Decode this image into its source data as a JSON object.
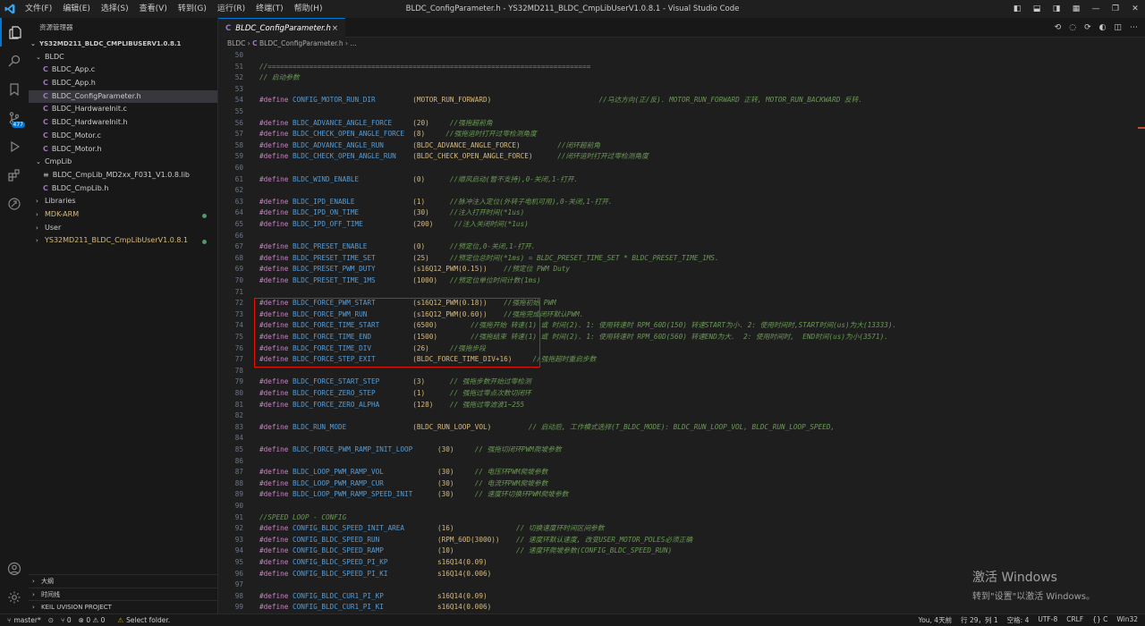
{
  "titlebar": {
    "menus": [
      "文件(F)",
      "编辑(E)",
      "选择(S)",
      "查看(V)",
      "转到(G)",
      "运行(R)",
      "终端(T)",
      "帮助(H)"
    ],
    "title": "BLDC_ConfigParameter.h - YS32MD211_BLDC_CmpLibUserV1.0.8.1 - Visual Studio Code"
  },
  "activity": {
    "badge": "477"
  },
  "sidebar": {
    "title": "资源管理器",
    "root": "YS32MD211_BLDC_CMPLIBUSERV1.0.8.1",
    "items": [
      {
        "label": "BLDC",
        "kind": "folder-open"
      },
      {
        "label": "BLDC_App.c",
        "kind": "c"
      },
      {
        "label": "BLDC_App.h",
        "kind": "c"
      },
      {
        "label": "BLDC_ConfigParameter.h",
        "kind": "c",
        "selected": true
      },
      {
        "label": "BLDC_HardwareInit.c",
        "kind": "c"
      },
      {
        "label": "BLDC_HardwareInit.h",
        "kind": "c"
      },
      {
        "label": "BLDC_Motor.c",
        "kind": "c"
      },
      {
        "label": "BLDC_Motor.h",
        "kind": "c"
      },
      {
        "label": "CmpLib",
        "kind": "folder-open"
      },
      {
        "label": "BLDC_CmpLib_MD2xx_F031_V1.0.8.lib",
        "kind": "lib"
      },
      {
        "label": "BLDC_CmpLib.h",
        "kind": "c"
      },
      {
        "label": "Libraries",
        "kind": "folder"
      },
      {
        "label": "MDK-ARM",
        "kind": "folder",
        "modified": true
      },
      {
        "label": "User",
        "kind": "folder"
      },
      {
        "label": "YS32MD211_BLDC_CmpLibUserV1.0.8.1",
        "kind": "folder",
        "modified": true
      }
    ],
    "bottom": [
      "大纲",
      "时间线",
      "KEIL UVISION PROJECT"
    ]
  },
  "tab": {
    "label": "BLDC_ConfigParameter.h",
    "close": "×"
  },
  "breadcrumb": {
    "folder": "BLDC",
    "file": "BLDC_ConfigParameter.h",
    "rest": "..."
  },
  "code": [
    {
      "n": "50",
      "parts": []
    },
    {
      "n": "51",
      "parts": [
        [
          "cm",
          "//=============================================================================="
        ]
      ]
    },
    {
      "n": "52",
      "parts": [
        [
          "cm",
          "// 启动参数"
        ]
      ]
    },
    {
      "n": "53",
      "parts": []
    },
    {
      "n": "54",
      "parts": [
        [
          "kw",
          "#define "
        ],
        [
          "mac",
          "CONFIG_MOTOR_RUN_DIR         "
        ],
        [
          "val",
          "(MOTOR_RUN_FORWARD)                          "
        ],
        [
          "cm",
          "//马达方向(正/反). MOTOR_RUN_FORWARD 正转, MOTOR_RUN_BACKWARD 反转."
        ]
      ]
    },
    {
      "n": "55",
      "parts": []
    },
    {
      "n": "56",
      "parts": [
        [
          "kw",
          "#define "
        ],
        [
          "mac",
          "BLDC_ADVANCE_ANGLE_FORCE     "
        ],
        [
          "val",
          "(20)"
        ],
        [
          "cm",
          "     //强拖超前角"
        ]
      ]
    },
    {
      "n": "57",
      "parts": [
        [
          "kw",
          "#define "
        ],
        [
          "mac",
          "BLDC_CHECK_OPEN_ANGLE_FORCE  "
        ],
        [
          "val",
          "(8)"
        ],
        [
          "cm",
          "     //强拖运时打开过零检测角度"
        ]
      ]
    },
    {
      "n": "58",
      "parts": [
        [
          "kw",
          "#define "
        ],
        [
          "mac",
          "BLDC_ADVANCE_ANGLE_RUN       "
        ],
        [
          "val",
          "(BLDC_ADVANCE_ANGLE_FORCE)"
        ],
        [
          "cm",
          "         //闭环超前角"
        ]
      ]
    },
    {
      "n": "59",
      "parts": [
        [
          "kw",
          "#define "
        ],
        [
          "mac",
          "BLDC_CHECK_OPEN_ANGLE_RUN    "
        ],
        [
          "val",
          "(BLDC_CHECK_OPEN_ANGLE_FORCE)"
        ],
        [
          "cm",
          "      //闭环运时打开过零检测角度"
        ]
      ]
    },
    {
      "n": "60",
      "parts": []
    },
    {
      "n": "61",
      "parts": [
        [
          "kw",
          "#define "
        ],
        [
          "mac",
          "BLDC_WIND_ENABLE             "
        ],
        [
          "val",
          "(0)"
        ],
        [
          "cm",
          "      //顺风启动(暂不支持),0-关闭,1-打开."
        ]
      ]
    },
    {
      "n": "62",
      "parts": []
    },
    {
      "n": "63",
      "parts": [
        [
          "kw",
          "#define "
        ],
        [
          "mac",
          "BLDC_IPD_ENABLE              "
        ],
        [
          "val",
          "(1)"
        ],
        [
          "cm",
          "      //脉冲注入定位(外转子电机可用),0-关闭,1-打开."
        ]
      ]
    },
    {
      "n": "64",
      "parts": [
        [
          "kw",
          "#define "
        ],
        [
          "mac",
          "BLDC_IPD_ON_TIME             "
        ],
        [
          "val",
          "(30)"
        ],
        [
          "cm",
          "     //注入打开时间(*1us)"
        ]
      ]
    },
    {
      "n": "65",
      "parts": [
        [
          "kw",
          "#define "
        ],
        [
          "mac",
          "BLDC_IPD_OFF_TIME            "
        ],
        [
          "val",
          "(200)"
        ],
        [
          "cm",
          "     //注入关闭时间(*1us)"
        ]
      ]
    },
    {
      "n": "66",
      "parts": []
    },
    {
      "n": "67",
      "parts": [
        [
          "kw",
          "#define "
        ],
        [
          "mac",
          "BLDC_PRESET_ENABLE           "
        ],
        [
          "val",
          "(0)"
        ],
        [
          "cm",
          "      //预定位,0-关闭,1-打开."
        ]
      ]
    },
    {
      "n": "68",
      "parts": [
        [
          "kw",
          "#define "
        ],
        [
          "mac",
          "BLDC_PRESET_TIME_SET         "
        ],
        [
          "val",
          "(25)"
        ],
        [
          "cm",
          "     //预定位总时间(*1ms) = BLDC_PRESET_TIME_SET * BLDC_PRESET_TIME_1MS."
        ]
      ]
    },
    {
      "n": "69",
      "parts": [
        [
          "kw",
          "#define "
        ],
        [
          "mac",
          "BLDC_PRESET_PWM_DUTY         "
        ],
        [
          "val",
          "(s16Q12_PWM(0.15))"
        ],
        [
          "cm",
          "    //预定位 PWM Duty"
        ]
      ]
    },
    {
      "n": "70",
      "parts": [
        [
          "kw",
          "#define "
        ],
        [
          "mac",
          "BLDC_PRESET_TIME_1MS         "
        ],
        [
          "val",
          "(1000)"
        ],
        [
          "cm",
          "   //预定位单位时间计数(1ms)"
        ]
      ]
    },
    {
      "n": "71",
      "parts": []
    },
    {
      "n": "72",
      "parts": [
        [
          "kw",
          "#define "
        ],
        [
          "mac",
          "BLDC_FORCE_PWM_START         "
        ],
        [
          "val",
          "(s16Q12_PWM(0.18))"
        ],
        [
          "cm",
          "    //强拖初始 PWM"
        ]
      ]
    },
    {
      "n": "73",
      "parts": [
        [
          "kw",
          "#define "
        ],
        [
          "mac",
          "BLDC_FORCE_PWM_RUN           "
        ],
        [
          "val",
          "(s16Q12_PWM(0.60))"
        ],
        [
          "cm",
          "    //强拖完成闭环默认PWM."
        ]
      ]
    },
    {
      "n": "74",
      "parts": [
        [
          "kw",
          "#define "
        ],
        [
          "mac",
          "BLDC_FORCE_TIME_START        "
        ],
        [
          "val",
          "(6500)"
        ],
        [
          "cm",
          "        //强拖开始 转速(1) 或 时间(2). 1: 使用转速时 RPM_60D(150) 转速START为小. 2: 使用时间时,START时间(us)为大(13333)."
        ]
      ]
    },
    {
      "n": "75",
      "parts": [
        [
          "kw",
          "#define "
        ],
        [
          "mac",
          "BLDC_FORCE_TIME_END          "
        ],
        [
          "val",
          "(1500)"
        ],
        [
          "cm",
          "        //强拖结束 转速(1) 或 时间(2). 1: 使用转速时 RPM_60D(560) 转速END为大.  2: 使用时间时,  END时间(us)为小(3571)."
        ]
      ]
    },
    {
      "n": "76",
      "parts": [
        [
          "kw",
          "#define "
        ],
        [
          "mac",
          "BLDC_FORCE_TIME_DIV          "
        ],
        [
          "val",
          "(26)"
        ],
        [
          "cm",
          "     //强拖步段"
        ]
      ]
    },
    {
      "n": "77",
      "parts": [
        [
          "kw",
          "#define "
        ],
        [
          "mac",
          "BLDC_FORCE_STEP_EXIT         "
        ],
        [
          "val",
          "(BLDC_FORCE_TIME_DIV+16)"
        ],
        [
          "cm",
          "     //强拖超时重启步数"
        ]
      ]
    },
    {
      "n": "78",
      "parts": []
    },
    {
      "n": "79",
      "parts": [
        [
          "kw",
          "#define "
        ],
        [
          "mac",
          "BLDC_FORCE_START_STEP        "
        ],
        [
          "val",
          "(3)"
        ],
        [
          "cm",
          "      // 强拖步数开始过零检测"
        ]
      ]
    },
    {
      "n": "80",
      "parts": [
        [
          "kw",
          "#define "
        ],
        [
          "mac",
          "BLDC_FORCE_ZERO_STEP         "
        ],
        [
          "val",
          "(1)"
        ],
        [
          "cm",
          "      // 强拖过零点次数切闭环"
        ]
      ]
    },
    {
      "n": "81",
      "parts": [
        [
          "kw",
          "#define "
        ],
        [
          "mac",
          "BLDC_FORCE_ZERO_ALPHA        "
        ],
        [
          "val",
          "(128)"
        ],
        [
          "cm",
          "    // 强拖过零滤波1~255"
        ]
      ]
    },
    {
      "n": "82",
      "parts": []
    },
    {
      "n": "83",
      "parts": [
        [
          "kw",
          "#define "
        ],
        [
          "mac",
          "BLDC_RUN_MODE                "
        ],
        [
          "val",
          "(BLDC_RUN_LOOP_VOL)"
        ],
        [
          "cm",
          "         // 启动后, 工作模式选择(T_BLDC_MODE): BLDC_RUN_LOOP_VOL, BLDC_RUN_LOOP_SPEED,"
        ]
      ]
    },
    {
      "n": "84",
      "parts": []
    },
    {
      "n": "85",
      "parts": [
        [
          "kw",
          "#define "
        ],
        [
          "mac",
          "BLDC_FORCE_PWM_RAMP_INIT_LOOP      "
        ],
        [
          "val",
          "(30)"
        ],
        [
          "cm",
          "     // 强拖切闭环PWM爬坡参数"
        ]
      ]
    },
    {
      "n": "86",
      "parts": []
    },
    {
      "n": "87",
      "parts": [
        [
          "kw",
          "#define "
        ],
        [
          "mac",
          "BLDC_LOOP_PWM_RAMP_VOL             "
        ],
        [
          "val",
          "(30)"
        ],
        [
          "cm",
          "     // 电压环PWM爬坡参数"
        ]
      ]
    },
    {
      "n": "88",
      "parts": [
        [
          "kw",
          "#define "
        ],
        [
          "mac",
          "BLDC_LOOP_PWM_RAMP_CUR             "
        ],
        [
          "val",
          "(30)"
        ],
        [
          "cm",
          "     // 电流环PWM爬坡参数"
        ]
      ]
    },
    {
      "n": "89",
      "parts": [
        [
          "kw",
          "#define "
        ],
        [
          "mac",
          "BLDC_LOOP_PWM_RAMP_SPEED_INIT      "
        ],
        [
          "val",
          "(30)"
        ],
        [
          "cm",
          "     // 速度环切换环PWM爬坡参数"
        ]
      ]
    },
    {
      "n": "90",
      "parts": []
    },
    {
      "n": "91",
      "parts": [
        [
          "cm",
          "//SPEED LOOP - CONFIG"
        ]
      ]
    },
    {
      "n": "92",
      "parts": [
        [
          "kw",
          "#define "
        ],
        [
          "mac",
          "CONFIG_BLDC_SPEED_INIT_AREA        "
        ],
        [
          "val",
          "(16)"
        ],
        [
          "cm",
          "               // 切换速度环时间区间参数"
        ]
      ]
    },
    {
      "n": "93",
      "parts": [
        [
          "kw",
          "#define "
        ],
        [
          "mac",
          "CONFIG_BLDC_SPEED_RUN              "
        ],
        [
          "val",
          "(RPM_60D(3000))"
        ],
        [
          "cm",
          "    // 速度环默认速度, 改变USER_MOTOR_POLES必须正确"
        ]
      ]
    },
    {
      "n": "94",
      "parts": [
        [
          "kw",
          "#define "
        ],
        [
          "mac",
          "CONFIG_BLDC_SPEED_RAMP             "
        ],
        [
          "val",
          "(10)"
        ],
        [
          "cm",
          "               // 速度环爬坡参数(CONFIG_BLDC_SPEED_RUN)"
        ]
      ]
    },
    {
      "n": "95",
      "parts": [
        [
          "kw",
          "#define "
        ],
        [
          "mac",
          "CONFIG_BLDC_SPEED_PI_KP            "
        ],
        [
          "val",
          "s16Q14(0.09)"
        ]
      ]
    },
    {
      "n": "96",
      "parts": [
        [
          "kw",
          "#define "
        ],
        [
          "mac",
          "CONFIG_BLDC_SPEED_PI_KI            "
        ],
        [
          "val",
          "s16Q14(0.006)"
        ]
      ]
    },
    {
      "n": "97",
      "parts": []
    },
    {
      "n": "98",
      "parts": [
        [
          "kw",
          "#define "
        ],
        [
          "mac",
          "CONFIG_BLDC_CUR1_PI_KP             "
        ],
        [
          "val",
          "s16Q14(0.09)"
        ]
      ]
    },
    {
      "n": "99",
      "parts": [
        [
          "kw",
          "#define "
        ],
        [
          "mac",
          "CONFIG_BLDC_CUR1_PI_KI             "
        ],
        [
          "val",
          "s16Q14(0.006)"
        ]
      ]
    }
  ],
  "watermark": {
    "line1": "激活 Windows",
    "line2": "转到\"设置\"以激活 Windows。"
  },
  "status": {
    "branch": "master*",
    "errors": "⊗ 0 ⚠ 0",
    "ports": "⑂ 0",
    "select_folder": "Select folder.",
    "right": [
      "You, 4天前",
      "行 29，列 1",
      "空格: 4",
      "UTF-8",
      "CRLF",
      "{} C",
      "Win32"
    ]
  },
  "colors": {
    "accent": "#0078d4",
    "highlight_box": "#e51400"
  }
}
